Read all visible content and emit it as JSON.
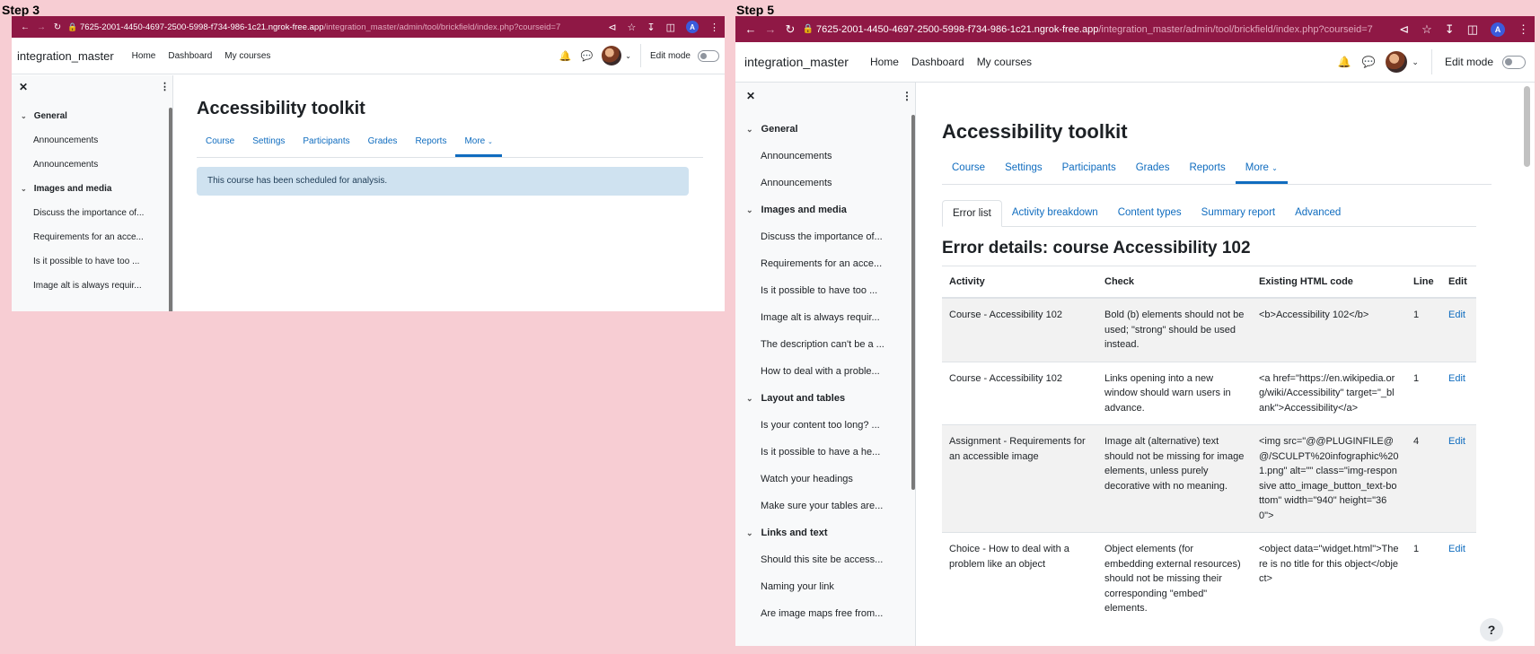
{
  "steps": [
    {
      "label": "Step 3"
    },
    {
      "label": "Step 5"
    }
  ],
  "browser": {
    "url_host": "7625-2001-4450-4697-2500-5998-f734-986-1c21.ngrok-free.app",
    "url_path": "/integration_master/admin/tool/brickfield/index.php?courseid=7",
    "profile_initial": "A"
  },
  "site": {
    "name": "integration_master",
    "nav": [
      "Home",
      "Dashboard",
      "My courses"
    ],
    "edit_mode_label": "Edit mode"
  },
  "drawer": {
    "sections": [
      {
        "title": "General",
        "items": [
          "Announcements",
          "Announcements"
        ]
      },
      {
        "title": "Images and media",
        "items": [
          "Discuss the importance of...",
          "Requirements for an acce...",
          "Is it possible to have too ...",
          "Image alt is always requir...",
          "The description can't be a ...",
          "How to deal with a proble..."
        ]
      },
      {
        "title": "Layout and tables",
        "items": [
          "Is your content too long? ...",
          "Is it possible to have a he...",
          "Watch your headings",
          "Make sure your tables are..."
        ]
      },
      {
        "title": "Links and text",
        "items": [
          "Should this site be access...",
          "Naming your link",
          "Are image maps free from..."
        ]
      }
    ]
  },
  "page": {
    "title": "Accessibility toolkit",
    "tabs": [
      "Course",
      "Settings",
      "Participants",
      "Grades",
      "Reports",
      "More"
    ],
    "alert": "This course has been scheduled for analysis.",
    "subtabs": [
      "Error list",
      "Activity breakdown",
      "Content types",
      "Summary report",
      "Advanced"
    ],
    "error_heading": "Error details: course Accessibility 102",
    "table": {
      "headers": [
        "Activity",
        "Check",
        "Existing HTML code",
        "Line",
        "Edit"
      ],
      "rows": [
        {
          "activity": "Course - Accessibility 102",
          "check": "Bold (b) elements should not be used; \"strong\" should be used instead.",
          "code": "<b>Accessibility 102</b>",
          "line": "1",
          "edit": "Edit"
        },
        {
          "activity": "Course - Accessibility 102",
          "check": "Links opening into a new window should warn users in advance.",
          "code": "<a href=\"https://en.wikipedia.org/wiki/Accessibility\" target=\"_blank\">Accessibility</a>",
          "line": "1",
          "edit": "Edit"
        },
        {
          "activity": "Assignment - Requirements for an accessible image",
          "check": "Image alt (alternative) text should not be missing for image elements, unless purely decorative with no meaning.",
          "code": "<img src=\"@@PLUGINFILE@@/SCULPT%20infographic%201.png\" alt=\"\" class=\"img-responsive atto_image_button_text-bottom\" width=\"940\" height=\"360\">",
          "line": "4",
          "edit": "Edit"
        },
        {
          "activity": "Choice - How to deal with a problem like an object",
          "check": "Object elements (for embedding external resources) should not be missing their corresponding \"embed\" elements.",
          "code": "<object data=\"widget.html\">There is no title for this object</object>",
          "line": "1",
          "edit": "Edit"
        }
      ]
    },
    "help": "?"
  },
  "colors": {
    "chrome": "#8f1845",
    "link": "#0f6cbf",
    "alert_bg": "#cfe2f0",
    "background": "#f7cdd3"
  }
}
